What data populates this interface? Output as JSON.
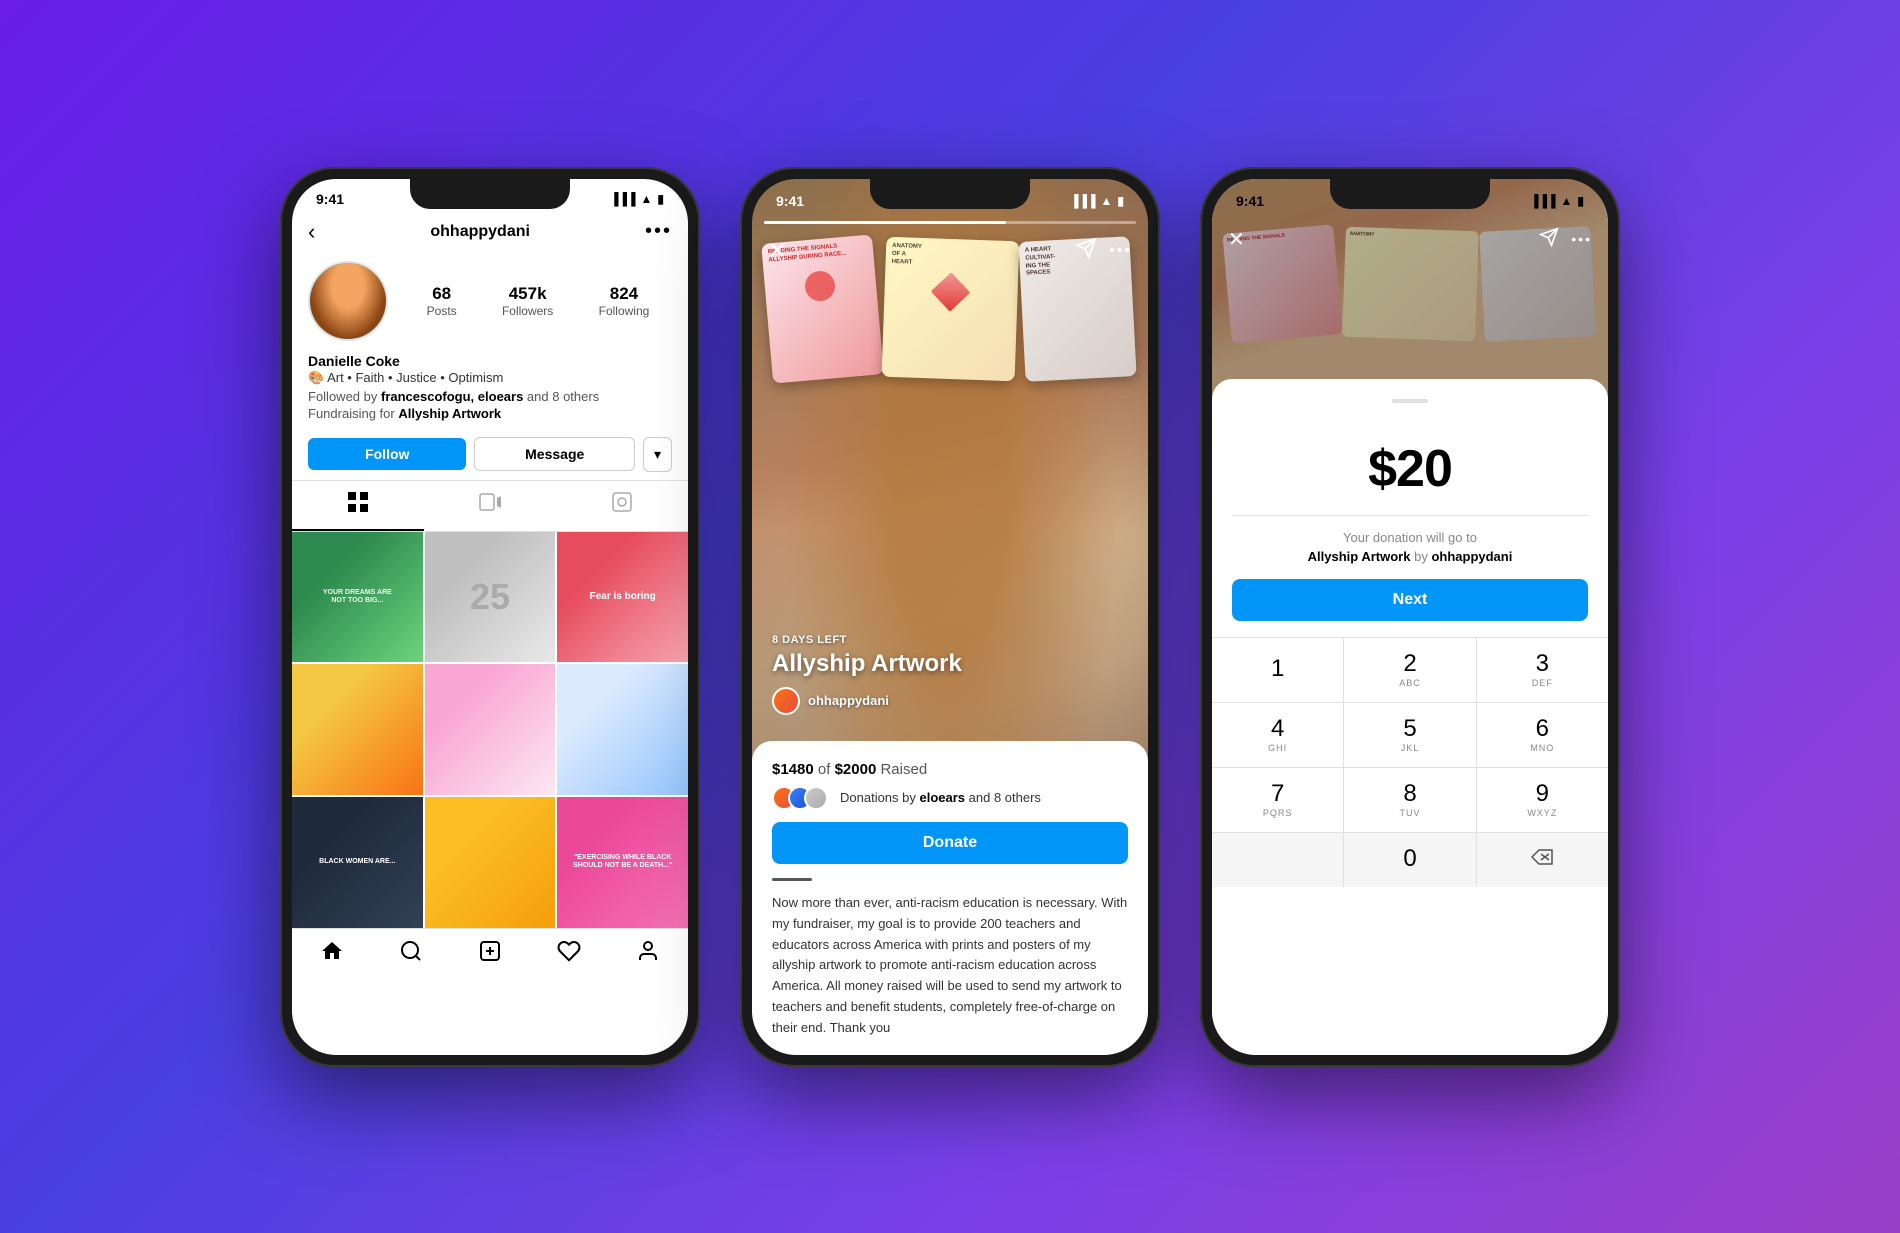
{
  "background": {
    "gradient": "purple to blue"
  },
  "phone1": {
    "status_bar": {
      "time": "9:41",
      "icons": "●●● WiFi Battery"
    },
    "header": {
      "back_label": "‹",
      "username": "ohhappydani",
      "more_label": "•••"
    },
    "stats": {
      "posts_count": "68",
      "posts_label": "Posts",
      "followers_count": "457k",
      "followers_label": "Followers",
      "following_count": "824",
      "following_label": "Following"
    },
    "profile": {
      "name": "Danielle Coke",
      "bio": "🎨 Art • Faith • Justice • Optimism",
      "followed_by": "Followed by ",
      "followed_names": "francescofogu, eloears",
      "followed_suffix": " and 8 others",
      "fundraising_prefix": "Fundraising for ",
      "fundraising_name": "Allyship Artwork"
    },
    "actions": {
      "follow_label": "Follow",
      "message_label": "Message",
      "dropdown_label": "▾"
    },
    "tabs": {
      "grid_icon": "⊞",
      "video_icon": "▷",
      "tag_icon": "⊙"
    },
    "bottom_nav": {
      "home": "⌂",
      "search": "⊕",
      "plus": "⊕",
      "heart": "♡",
      "person": "⊙"
    },
    "grid_cells": [
      {
        "id": "gc1",
        "alt": "motivational text art"
      },
      {
        "id": "gc2",
        "alt": "25 balloon art",
        "text": "25"
      },
      {
        "id": "gc3",
        "alt": "fear is boring pink card"
      },
      {
        "id": "gc4",
        "alt": "colorful art yellow"
      },
      {
        "id": "gc5",
        "alt": "eye illustration pink"
      },
      {
        "id": "gc6",
        "alt": "blue illustration"
      },
      {
        "id": "gc7",
        "alt": "black women art"
      },
      {
        "id": "gc8",
        "alt": "smiling person yellow"
      },
      {
        "id": "gc9",
        "alt": "exercising while black pink"
      }
    ]
  },
  "phone2": {
    "status_bar": {
      "time": "9:41",
      "icons": "●●● WiFi Battery"
    },
    "story": {
      "days_left": "8 DAYS LEFT",
      "title": "Allyship Artwork",
      "author": "ohhappydani"
    },
    "fundraiser": {
      "raised_amount": "$1480",
      "goal_amount": "$2000",
      "raised_label": "of",
      "raised_suffix": "Raised",
      "donors_text": "Donations by ",
      "donor_names": "eloears",
      "donor_suffix": " and 8 others",
      "donate_label": "Donate"
    },
    "description": "Now more than ever, anti-racism education is necessary. With my fundraiser, my goal is to provide 200 teachers and educators across America with prints and posters of my allyship artwork to promote anti-racism education across America. All money raised will be used to send my artwork to teachers and benefit students, completely free-of-charge on their end. Thank you"
  },
  "phone3": {
    "status_bar": {
      "time": "9:41",
      "icons": "●●● WiFi Battery"
    },
    "amount": {
      "value": "$20",
      "currency": "$",
      "number": "20"
    },
    "donation_info": {
      "prefix": "Your donation will go to",
      "campaign": "Allyship Artwork",
      "by": "by ",
      "author": "ohhappydani"
    },
    "next_label": "Next",
    "keypad": [
      {
        "number": "1",
        "sub": ""
      },
      {
        "number": "2",
        "sub": "ABC"
      },
      {
        "number": "3",
        "sub": "DEF"
      },
      {
        "number": "4",
        "sub": "GHI"
      },
      {
        "number": "5",
        "sub": "JKL"
      },
      {
        "number": "6",
        "sub": "MNO"
      },
      {
        "number": "7",
        "sub": "PQRS"
      },
      {
        "number": "8",
        "sub": "TUV"
      },
      {
        "number": "9",
        "sub": "WXYZ"
      },
      {
        "number": "0",
        "sub": ""
      },
      {
        "number": "⌫",
        "sub": ""
      }
    ]
  }
}
